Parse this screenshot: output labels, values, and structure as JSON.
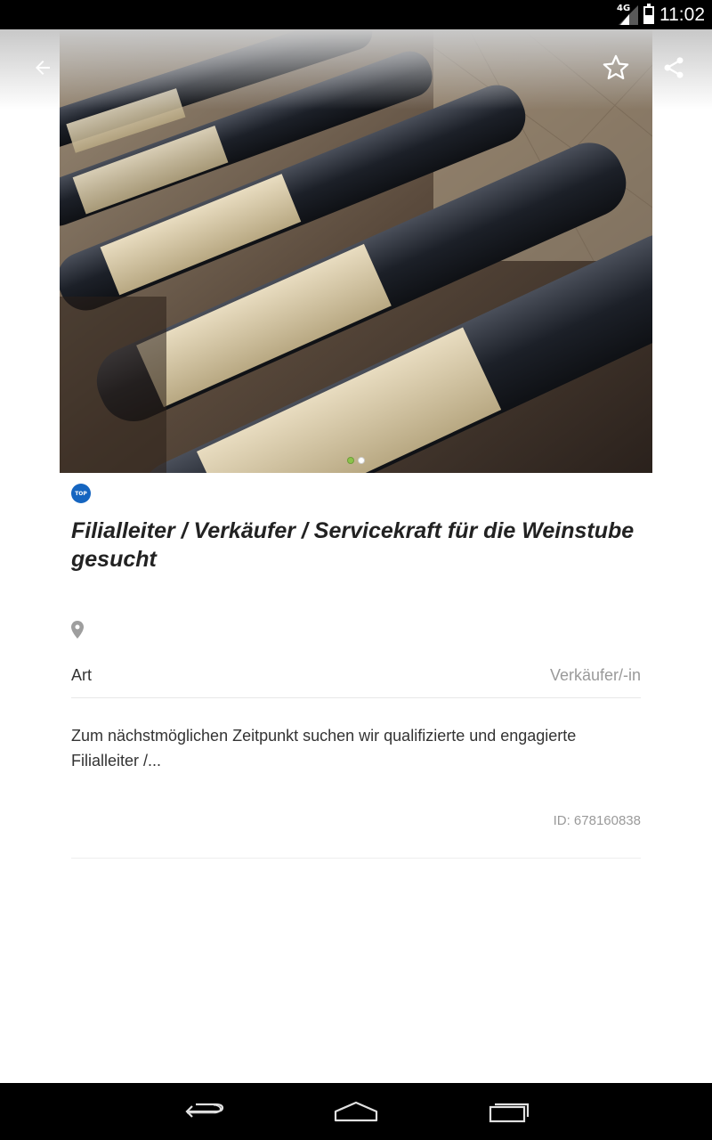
{
  "status_bar": {
    "network": "4G",
    "battery_level": 0.5,
    "time": "11:02"
  },
  "toolbar": {
    "back_icon": "arrow-back-icon",
    "favorite_icon": "star-outline-icon",
    "share_icon": "share-icon"
  },
  "gallery": {
    "image_description": "wine-bottles-photo",
    "page_count": 2,
    "current_page": 1
  },
  "listing": {
    "badge": "TOP",
    "title": "Filialleiter / Verkäufer / Servicekraft für die Weinstube gesucht",
    "location_icon": "location-pin-icon",
    "attribute_label": "Art",
    "attribute_value": "Verkäufer/-in",
    "description": "Zum nächstmöglichen Zeitpunkt suchen wir qualifizierte und engagierte Filialleiter /...",
    "id_text": "ID: 678160838"
  },
  "colors": {
    "accent_blue": "#1565c0",
    "pager_active": "#8bc34a",
    "muted_text": "#9a9a9a"
  },
  "nav_bar": {
    "back_icon": "nav-back-icon",
    "home_icon": "nav-home-icon",
    "recents_icon": "nav-recents-icon"
  }
}
